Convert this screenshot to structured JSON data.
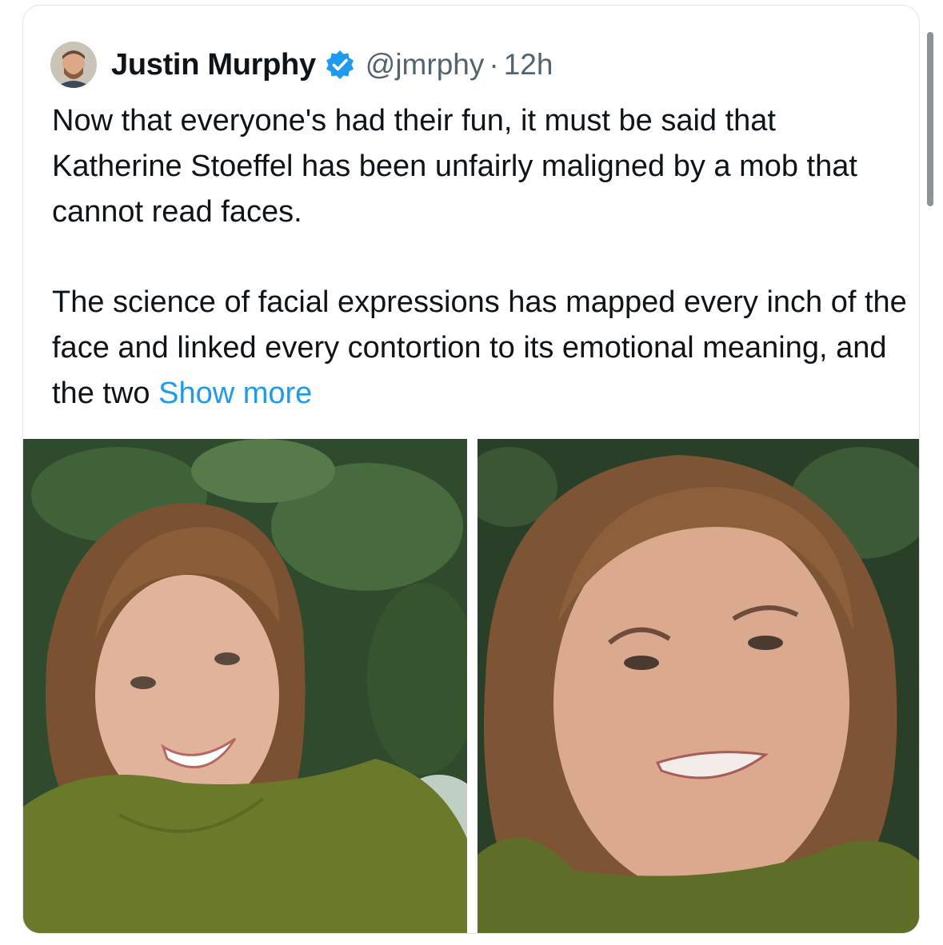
{
  "tweet": {
    "author_name": "Justin Murphy",
    "handle": "@jmrphy",
    "separator": "·",
    "time": "12h",
    "paragraph1": "Now that everyone's had their fun, it must be said that Katherine Stoeffel has been unfairly maligned by a mob that cannot read faces.",
    "paragraph2": "The science of facial expressions has mapped every inch of the face and linked every contortion to its emotional meaning, and the two",
    "show_more": "Show more"
  },
  "icons": {
    "avatar": "avatar",
    "verified": "verified-badge-icon"
  },
  "colors": {
    "link": "#1d9bf0",
    "secondary_text": "#536471",
    "verified": "#1d9bf0"
  }
}
